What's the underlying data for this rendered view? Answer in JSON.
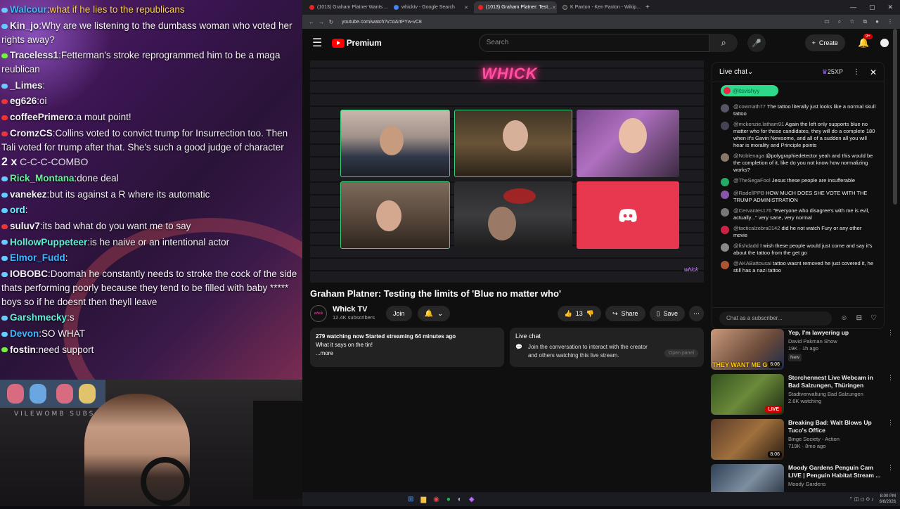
{
  "overlay": {
    "lines": [
      {
        "user": "Walcour",
        "sep": ":",
        "text": "what if he lies to the republicans",
        "color": "#3fb8ff",
        "textColor": "#ffd24a",
        "dot": "#6cf"
      },
      {
        "user": "Kin_jo",
        "sep": ":",
        "text": "Why are we listening to the dumbass woman who voted her rights away?",
        "color": "#f4f1f7",
        "textColor": "#f4f1f7",
        "dot": "#6cf"
      },
      {
        "user": "Traceless1",
        "sep": ":",
        "text": "Fetterman's stroke reprogrammed him to be a maga reublican",
        "color": "#f4f1f7",
        "textColor": "#f4f1f7",
        "dot": "#7e4"
      },
      {
        "user": "_Limes",
        "sep": ":",
        "text": "",
        "color": "#f4f1f7",
        "textColor": "#f4f1f7",
        "dot": "#6cf"
      },
      {
        "user": "eg626",
        "sep": ":",
        "text": "oi",
        "color": "#f4f1f7",
        "textColor": "#f4f1f7",
        "dot": "#e33"
      },
      {
        "user": "coffeePrimero",
        "sep": ":",
        "text": "a mout point!",
        "color": "#f4f1f7",
        "textColor": "#f4f1f7",
        "dot": "#e33"
      },
      {
        "user": "CromzCS",
        "sep": ":",
        "text": "Collins voted to convict trump for Insurrection too. Then Tali voted for trump after that. She's such a good judge of character",
        "color": "#f4f1f7",
        "textColor": "#f4f1f7",
        "dot": "#e33"
      }
    ],
    "combo": {
      "count": "2 x",
      "label": "C-C-C-COMBO"
    },
    "lines2": [
      {
        "user": "Rick_Montana",
        "sep": ":",
        "text": "done deal",
        "color": "#5cf58f",
        "textColor": "#f4f1f7",
        "dot": "#6cf"
      },
      {
        "user": "vanekez",
        "sep": ":",
        "text": "but its against a R where its automatic",
        "color": "#f4f1f7",
        "textColor": "#f4f1f7",
        "dot": "#6cf"
      },
      {
        "user": "ord",
        "sep": ":",
        "text": "",
        "color": "#6cf0ff",
        "textColor": "#f4f1f7",
        "dot": "#6cf"
      },
      {
        "user": "suluv7",
        "sep": ":",
        "text": "its bad what do you want me to say",
        "color": "#f4f1f7",
        "textColor": "#f4f1f7",
        "dot": "#e33"
      },
      {
        "user": "HollowPuppeteer",
        "sep": ":",
        "text": "is he naive or an intentional actor",
        "color": "#5cf0d4",
        "textColor": "#f4f1f7",
        "dot": "#6cf"
      },
      {
        "user": "Elmor_Fudd",
        "sep": ":",
        "text": "",
        "color": "#3fb8ff",
        "textColor": "#f4f1f7",
        "dot": "#6cf"
      },
      {
        "user": "IOBOBC",
        "sep": ":",
        "text": "Doomah he constantly needs to stroke the cock of the side thats performing poorly because they tend to be filled with baby ***** boys so if he doesnt then theyll leave",
        "color": "#f4f1f7",
        "textColor": "#f4f1f7",
        "dot": "#6cf"
      },
      {
        "user": "Garshmecky",
        "sep": ":",
        "text": "s",
        "color": "#5cf0d4",
        "textColor": "#f4f1f7",
        "dot": "#6cf"
      },
      {
        "user": "Devon",
        "sep": ":",
        "text": "SO WHAT",
        "color": "#3fb8ff",
        "textColor": "#f4f1f7",
        "dot": "#6cf"
      },
      {
        "user": "fostin",
        "sep": ":",
        "text": "need support",
        "color": "#f4f1f7",
        "textColor": "#f4f1f7",
        "dot": "#7e4"
      }
    ],
    "webcam_text": "VILEWOMB SUBS"
  },
  "browser": {
    "tabs": [
      {
        "label": "(1013) Graham Platner Wants ..."
      },
      {
        "label": "whicktv - Google Search"
      },
      {
        "label": "(1013) Graham Platner: Test..."
      },
      {
        "label": "K Paxton - Ken Paxton - Wikip..."
      }
    ],
    "url": "youtube.com/watch?v=oArtPYw-vC8"
  },
  "youtube": {
    "logo": "Premium",
    "search_placeholder": "Search",
    "create_label": "Create",
    "notif_badge": "9+",
    "video": {
      "neon_text": "WHICK",
      "title": "Graham Platner: Testing the limits of 'Blue no matter who'",
      "channel": "Whick TV",
      "subscribers": "12.4K subscribers",
      "join_label": "Join",
      "likes": "13",
      "share_label": "Share",
      "save_label": "Save",
      "watching": "279 watching now",
      "started": "Started streaming 64 minutes ago",
      "description": "What it says on the tin!",
      "more": "...more"
    },
    "livebox": {
      "header": "Live chat",
      "body": "Join the conversation to interact with the creator and others watching this live stream.",
      "open_panel": "Open panel"
    },
    "livechat": {
      "title": "Live chat",
      "xp": "25XP",
      "pinned": "@itsvishyy",
      "messages": [
        {
          "author": "@cowmath77",
          "text": "The tattoo literally just looks like a normal skull tattoo",
          "color": "#556"
        },
        {
          "author": "@mckenzie.latham91",
          "text": "Again the left only supports blue no matter who for these candidates, they will do a complete 180 when it's Gavin Newsome, and all of a sudden all you will hear is morality and Principle points",
          "color": "#445"
        },
        {
          "author": "@Noblenaga",
          "text": "@polygraphiedetector yeah and this would be the completion of it, like do you not know how normalizing works?",
          "color": "#876"
        },
        {
          "author": "@TheSegaFool",
          "text": "Jesus these people are insufferable",
          "color": "#2a6"
        },
        {
          "author": "@RadellPPB",
          "text": "HOW MUCH DOES SHE VOTE WITH THE TRUMP ADMINISTRATION",
          "color": "#85a"
        },
        {
          "author": "@Cervantes176",
          "text": "\"Everyone who disagree's with me is evil, actually...\" very sane, very normal",
          "color": "#777"
        },
        {
          "author": "@tacticalzebra0142",
          "text": "did he not watch Fury or any other movie",
          "color": "#c24"
        },
        {
          "author": "@fishdadd",
          "text": "I wish these people would just come and say it's about the tattoo from the get go",
          "color": "#888"
        },
        {
          "author": "@AKABattousai",
          "text": "tattoo wasnt removed he just covered it, he still has a nazi tattoo",
          "color": "#a53"
        }
      ],
      "input_placeholder": "Chat as a subscriber..."
    },
    "related": [
      {
        "title": "Yep, I'm lawyering up",
        "channel": "David Pakman Show",
        "meta": "19K · 1h ago",
        "badge": "New",
        "duration": "6:06",
        "caption": "THEY WANT ME GONE"
      },
      {
        "title": "Storchennest Live Webcam in Bad Salzungen, Thüringen",
        "channel": "Stadtverwaltung Bad Salzungen",
        "meta": "2.6K watching",
        "badge": "",
        "duration": "LIVE",
        "caption": ""
      },
      {
        "title": "Breaking Bad: Walt Blows Up Tuco's Office",
        "channel": "Binge Society - Action",
        "meta": "719K · 8mo ago",
        "badge": "",
        "duration": "8:06",
        "caption": ""
      },
      {
        "title": "Moody Gardens Penguin Cam LIVE | Penguin Habitat Stream ...",
        "channel": "Moody Gardens",
        "meta": "",
        "badge": "",
        "duration": "",
        "caption": ""
      }
    ]
  },
  "taskbar": {
    "time": "8:00 PM",
    "date": "6/8/2026"
  }
}
